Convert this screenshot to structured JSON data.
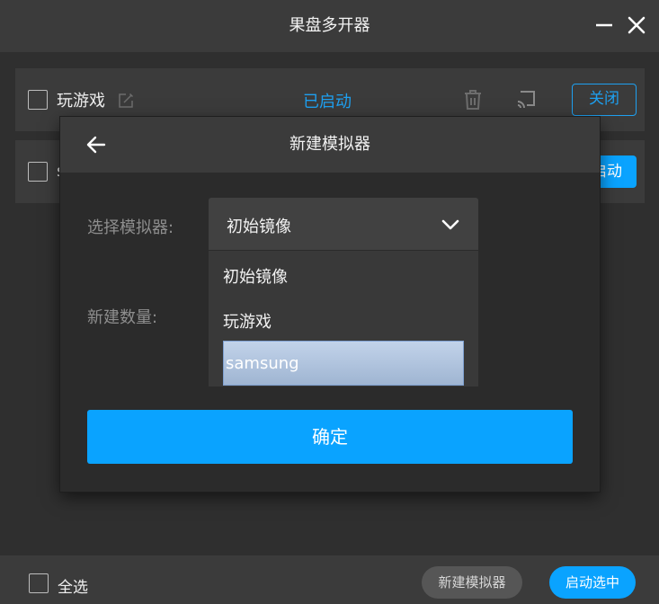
{
  "window": {
    "title": "果盘多开器"
  },
  "emulators": [
    {
      "name": "玩游戏",
      "status": "已启动",
      "action_label": "关闭"
    },
    {
      "name": "s",
      "action_label_partial": "启动"
    }
  ],
  "dialog": {
    "title": "新建模拟器",
    "select_label": "选择模拟器:",
    "count_label": "新建数量:",
    "selected_value": "初始镜像",
    "options": [
      "初始镜像",
      "玩游戏",
      "samsung"
    ],
    "highlighted_option": "samsung",
    "confirm_label": "确定"
  },
  "footer": {
    "select_all_label": "全选",
    "new_button_label": "新建模拟器",
    "start_selected_label": "启动选中"
  },
  "colors": {
    "accent": "#0aa3ff",
    "background": "#2f2f2f",
    "panel": "#3b3b3b"
  },
  "icons": [
    "minimize-icon",
    "close-icon",
    "edit-icon",
    "trash-icon",
    "cast-icon",
    "back-arrow-icon",
    "chevron-down-icon"
  ]
}
